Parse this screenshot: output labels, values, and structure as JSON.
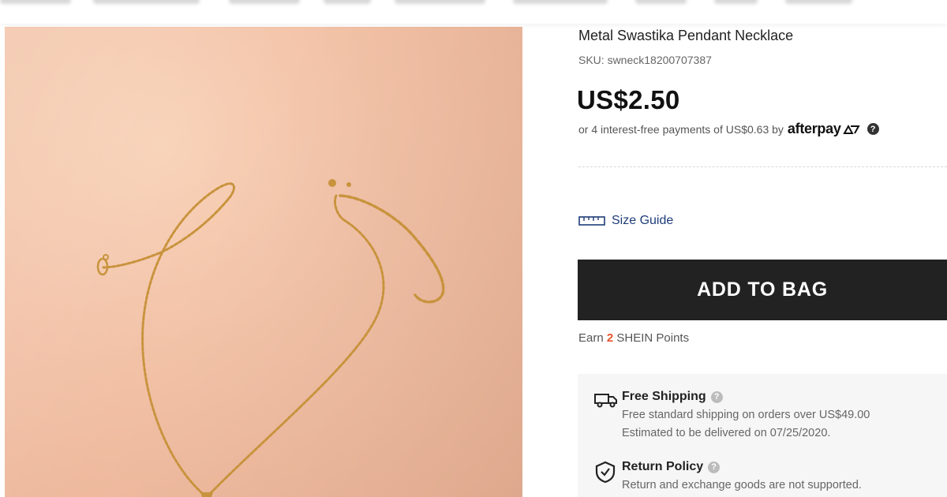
{
  "product": {
    "title": "Metal Swastika Pendant Necklace",
    "sku": "SKU: swneck18200707387",
    "price": "US$2.50",
    "installment_text": "or 4 interest-free payments of US$0.63 by",
    "afterpay_brand": "afterpay"
  },
  "size_guide": {
    "label": "Size Guide"
  },
  "cart": {
    "add_label": "ADD TO BAG"
  },
  "points": {
    "prefix": "Earn",
    "count": "2",
    "suffix": "SHEIN Points"
  },
  "shipping": {
    "title": "Free Shipping",
    "line1": "Free standard shipping on orders over US$49.00",
    "line2": "Estimated to be delivered on 07/25/2020."
  },
  "returns": {
    "title": "Return Policy",
    "line1": "Return and exchange goods are not supported."
  },
  "icons": {
    "help": "question-circle-icon",
    "ruler": "ruler-icon",
    "truck": "truck-icon",
    "shield": "shield-check-icon"
  },
  "colors": {
    "points_accent": "#e8542a",
    "button_bg": "#222222",
    "size_guide_link": "#1e3c78"
  }
}
